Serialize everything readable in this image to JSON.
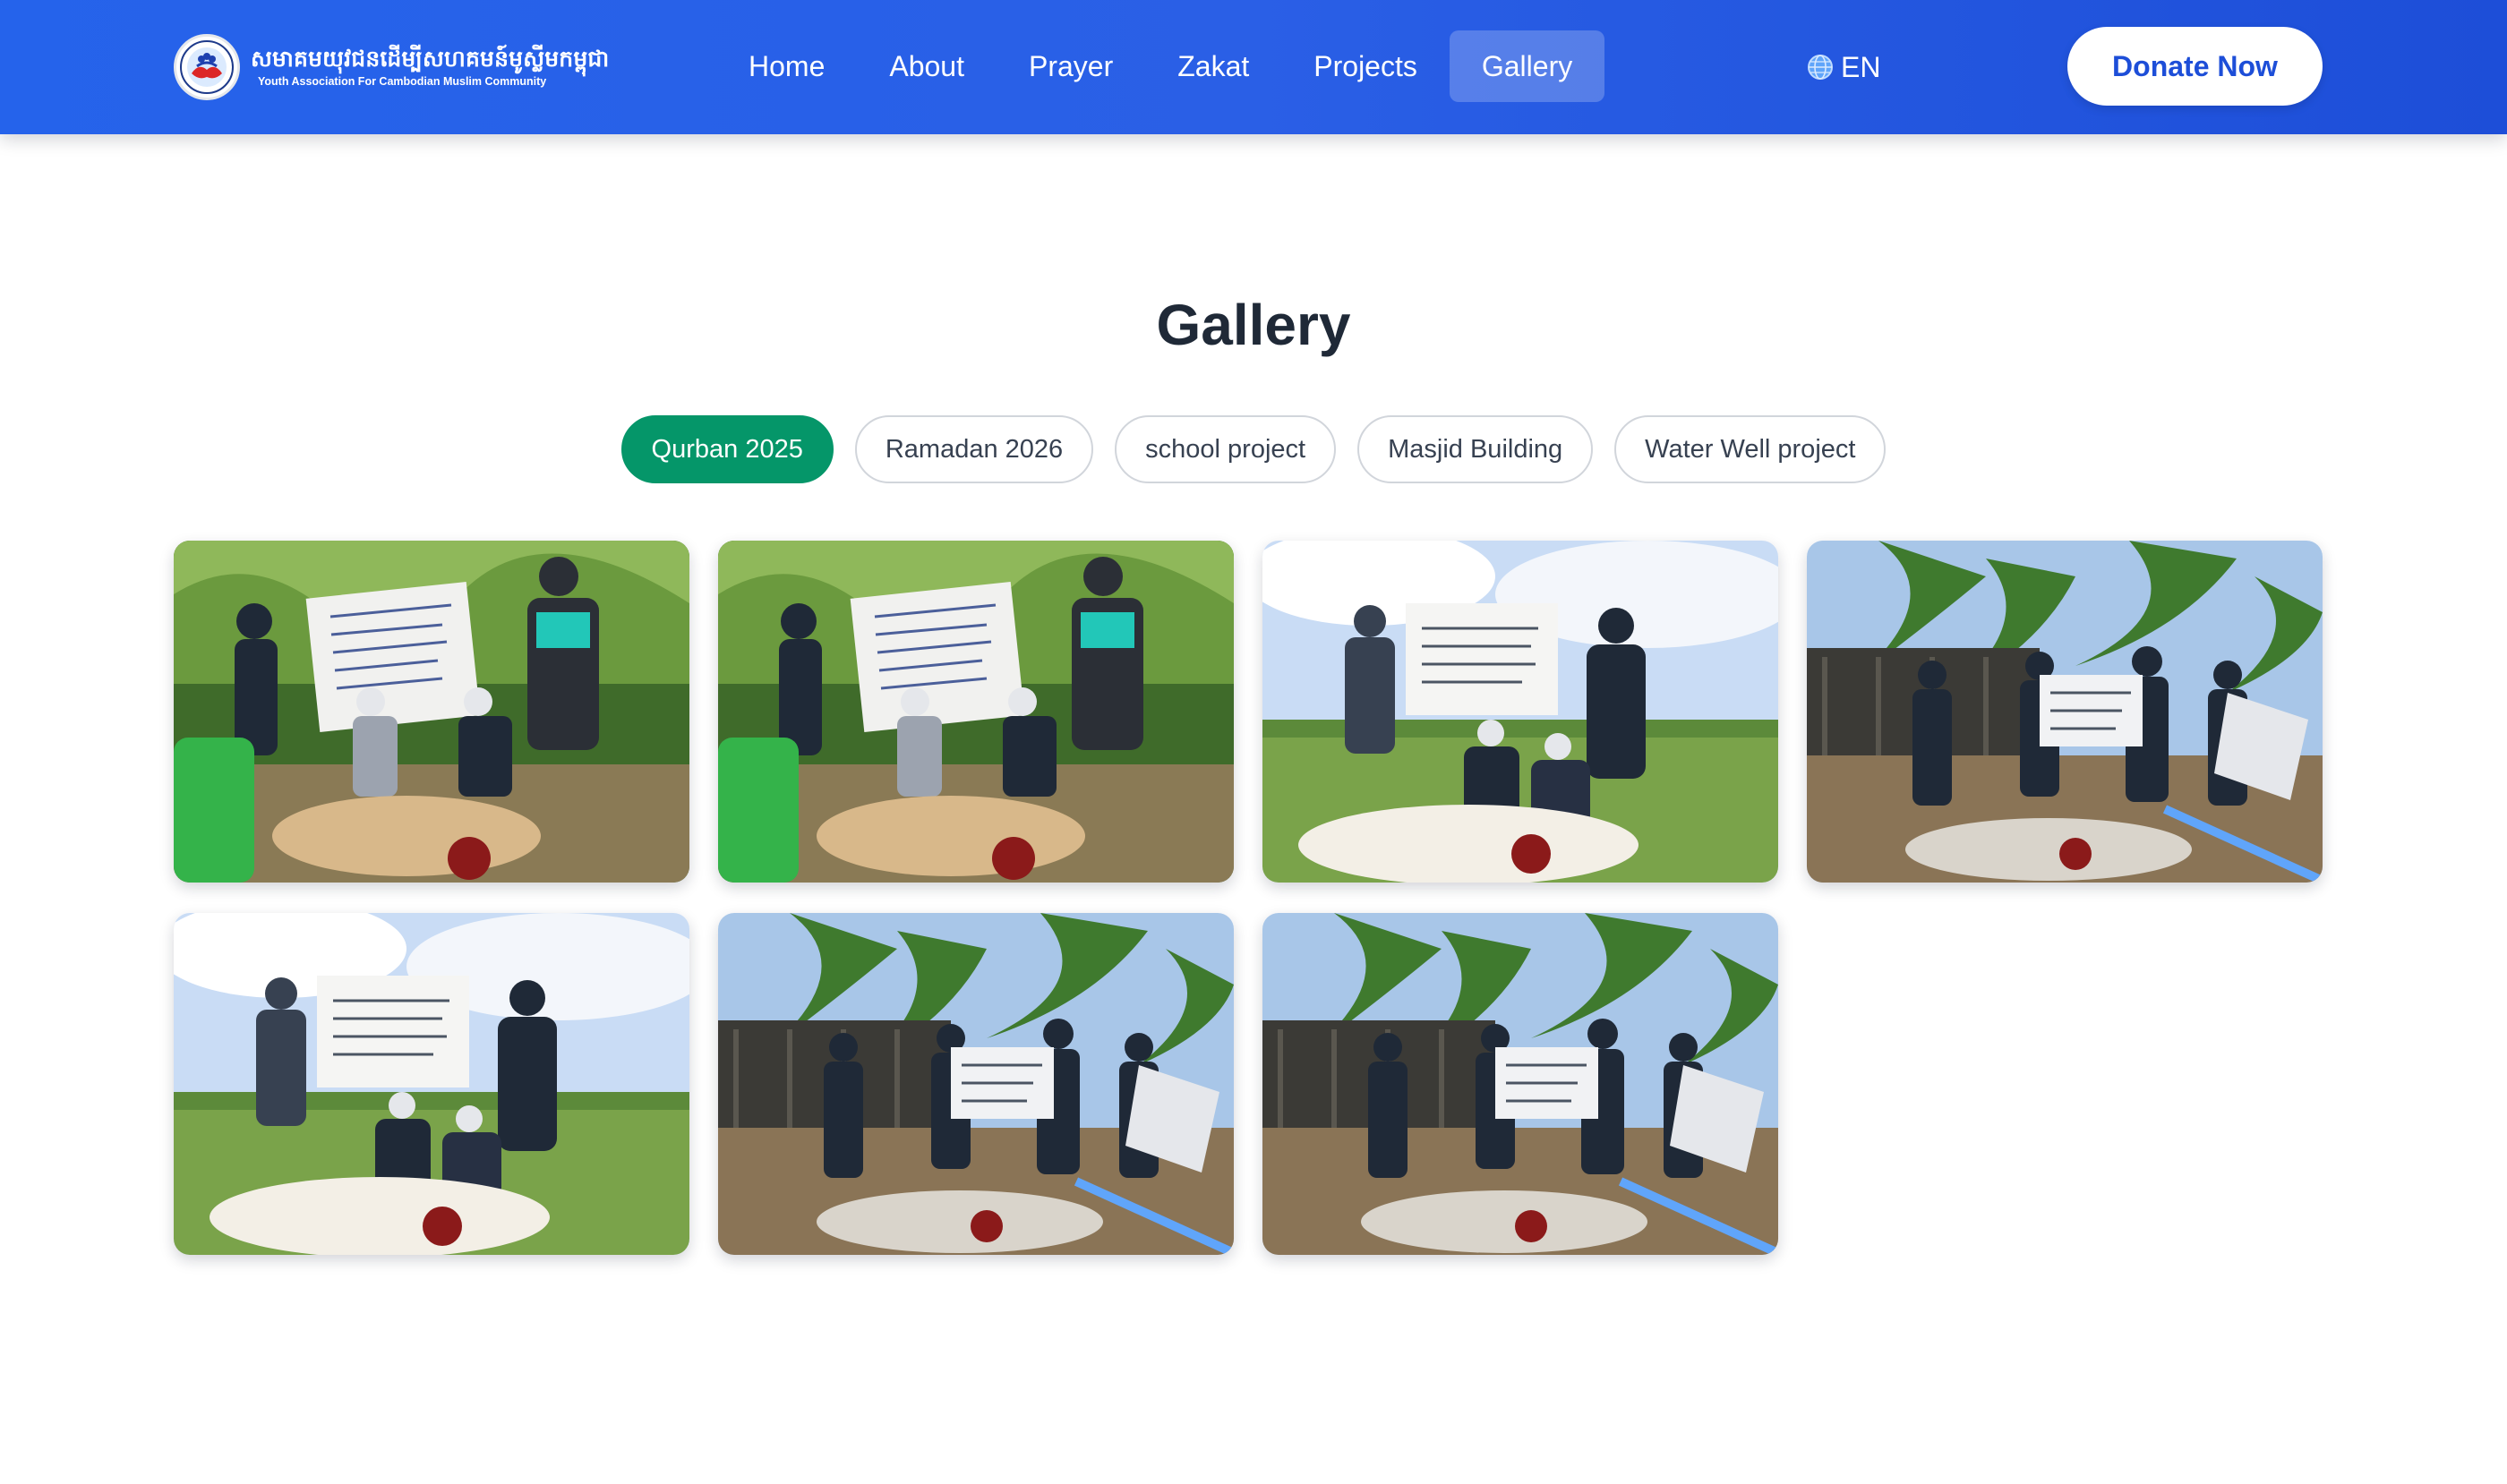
{
  "header": {
    "brand_khmer": "សមាគមយុវជនដើម្បីសហគមន៍មូស្លីមកម្ពុជា",
    "brand_english": "Youth Association For Cambodian Muslim Community",
    "nav": [
      {
        "label": "Home",
        "active": false
      },
      {
        "label": "About",
        "active": false
      },
      {
        "label": "Prayer",
        "active": false
      },
      {
        "label": "Zakat",
        "active": false
      },
      {
        "label": "Projects",
        "active": false
      },
      {
        "label": "Gallery",
        "active": true
      }
    ],
    "language": "EN",
    "donate_label": "Donate Now"
  },
  "main": {
    "title": "Gallery",
    "filters": [
      {
        "label": "Qurban 2025",
        "active": true
      },
      {
        "label": "Ramadan 2026",
        "active": false
      },
      {
        "label": "school project",
        "active": false
      },
      {
        "label": "Masjid Building",
        "active": false
      },
      {
        "label": "Water Well project",
        "active": false
      }
    ],
    "photos": [
      {
        "scene": "forest"
      },
      {
        "scene": "forest"
      },
      {
        "scene": "field"
      },
      {
        "scene": "palm"
      },
      {
        "scene": "field"
      },
      {
        "scene": "palm"
      },
      {
        "scene": "palm"
      }
    ]
  },
  "colors": {
    "header_gradient_start": "#2563eb",
    "header_gradient_end": "#1d4ed8",
    "active_filter": "#059669",
    "donate_text": "#1d4ed8"
  },
  "icons": {
    "logo": "org-logo-icon",
    "language": "globe-icon"
  }
}
